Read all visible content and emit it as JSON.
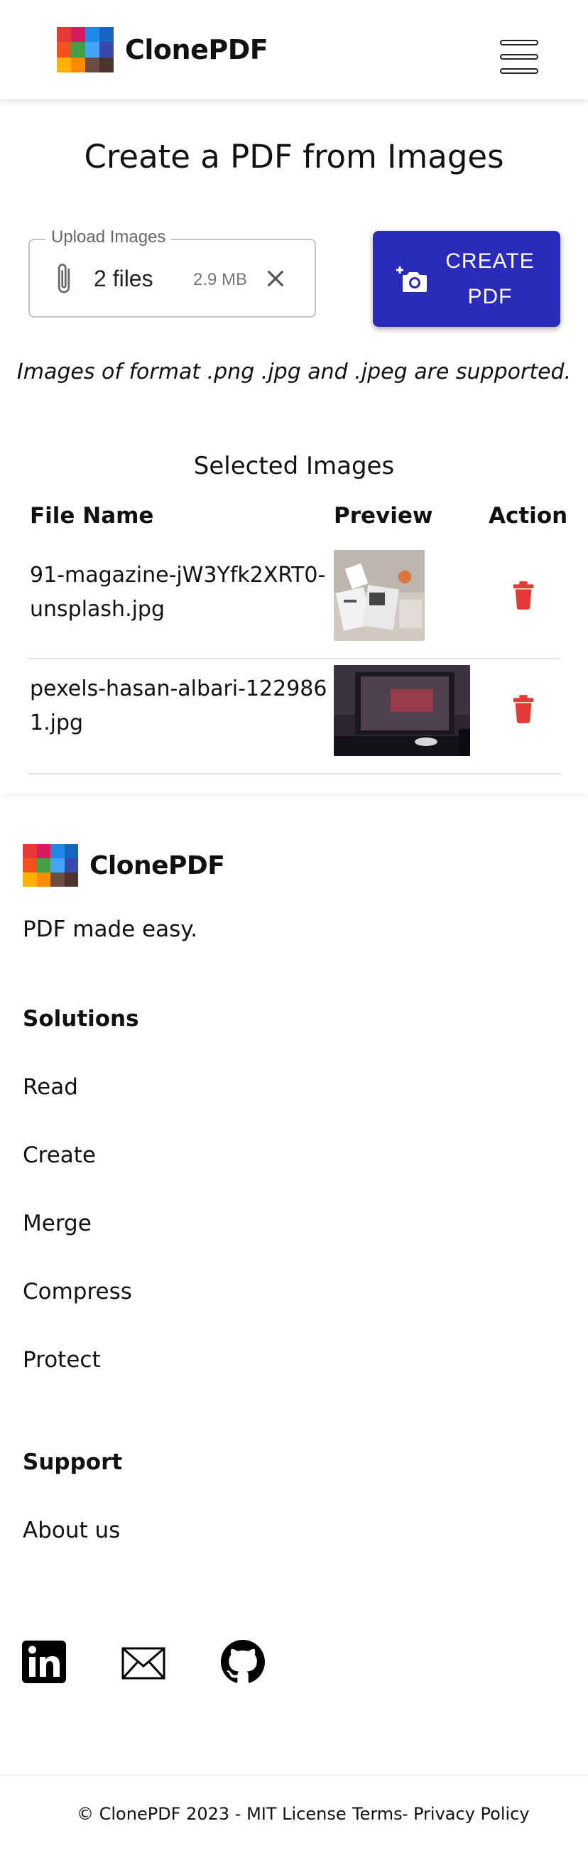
{
  "header": {
    "brand": "ClonePDF",
    "menu_icon": "hamburger-menu-icon"
  },
  "main": {
    "title": "Create a PDF from Images",
    "upload": {
      "legend": "Upload Images",
      "files_count": "2 files",
      "files_size": "2.9 MB",
      "attach_icon": "paperclip-icon",
      "clear_icon": "close-icon"
    },
    "create_button": {
      "line1": "CREATE",
      "line2": "PDF",
      "icon": "add-photo-camera-icon"
    },
    "supported_note": "Images of format .png .jpg and .jpeg are supported.",
    "selected_title": "Selected Images",
    "table": {
      "headers": [
        "File Name",
        "Preview",
        "Action"
      ],
      "rows": [
        {
          "file_name": "91-magazine-jW3Yfk2XRT0-unsplash.jpg",
          "preview_alt": "magazine photo thumbnail",
          "action_icon": "trash-icon"
        },
        {
          "file_name": "pexels-hasan-albari-1229861.jpg",
          "preview_alt": "laptop photo thumbnail",
          "action_icon": "trash-icon"
        }
      ]
    }
  },
  "footer": {
    "brand": "ClonePDF",
    "tagline": "PDF made easy.",
    "solutions_heading": "Solutions",
    "solutions": [
      "Read",
      "Create",
      "Merge",
      "Compress",
      "Protect"
    ],
    "support_heading": "Support",
    "support": [
      "About us"
    ],
    "social": [
      "linkedin-icon",
      "mail-icon",
      "github-icon"
    ],
    "copyright": "© ClonePDF 2023 - MIT License",
    "terms": "Terms",
    "separator": "-",
    "privacy": "Privacy Policy"
  },
  "colors": {
    "primary_button": "#2a2bb8",
    "delete_icon": "#e53935",
    "logo_tiles": [
      "#e53935",
      "#1e88e5",
      "#43a047",
      "#1565c0",
      "#f4511e",
      "#fdd835",
      "#8e24aa",
      "#3949ab",
      "#fb8c00",
      "#ffb300",
      "#6d4c41",
      "#5e35b1"
    ]
  }
}
